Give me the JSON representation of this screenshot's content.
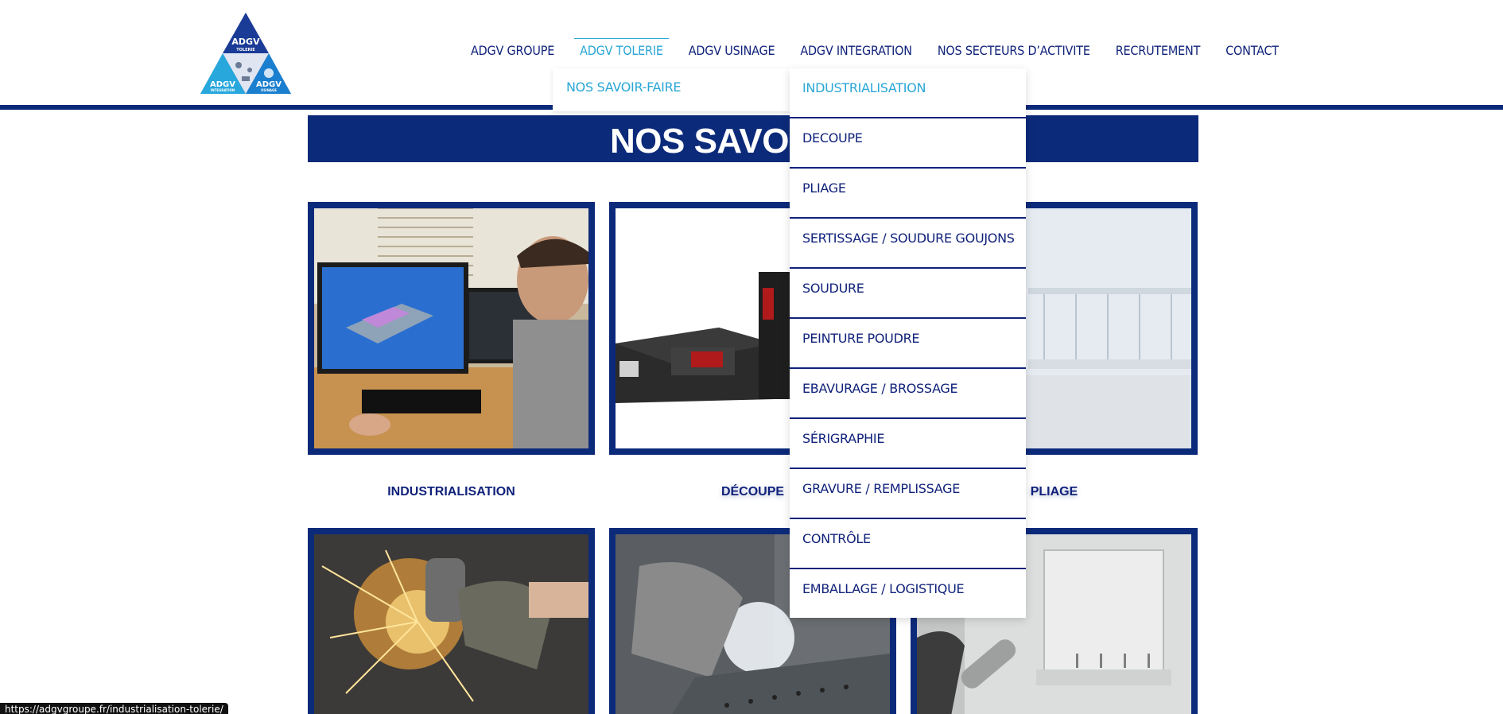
{
  "logo": {
    "top_text": "ADGV",
    "top_sub": "TOLERIE",
    "left_text": "ADGV",
    "left_sub": "INTEGRATION",
    "right_text": "ADGV",
    "right_sub": "USINAGE"
  },
  "nav": {
    "items": [
      {
        "label": "ADGV GROUPE"
      },
      {
        "label": "ADGV TOLERIE"
      },
      {
        "label": "ADGV USINAGE"
      },
      {
        "label": "ADGV INTEGRATION"
      },
      {
        "label": "NOS SECTEURS D’ACTIVITE"
      },
      {
        "label": "RECRUTEMENT"
      },
      {
        "label": "CONTACT"
      }
    ],
    "active_index": 1,
    "accent_color": "#2aa6d6",
    "primary_color": "#0c2a7a"
  },
  "submenu": {
    "item": "NOS SAVOIR-FAIRE"
  },
  "dropdown": {
    "items": [
      "INDUSTRIALISATION",
      "DECOUPE",
      "PLIAGE",
      "SERTISSAGE / SOUDURE GOUJONS",
      "SOUDURE",
      "PEINTURE POUDRE",
      "EBAVURAGE / BROSSAGE",
      "SÉRIGRAPHIE",
      "GRAVURE / REMPLISSAGE",
      "CONTRÔLE",
      "EMBALLAGE / LOGISTIQUE"
    ],
    "highlighted_index": 0
  },
  "banner": {
    "title": "NOS SAVOIR"
  },
  "cards": {
    "labels": [
      "INDUSTRIALISATION",
      "DÉCOUPE",
      "PLIAGE"
    ]
  },
  "status_bar": {
    "url": "https://adgvgroupe.fr/industrialisation-tolerie/"
  }
}
